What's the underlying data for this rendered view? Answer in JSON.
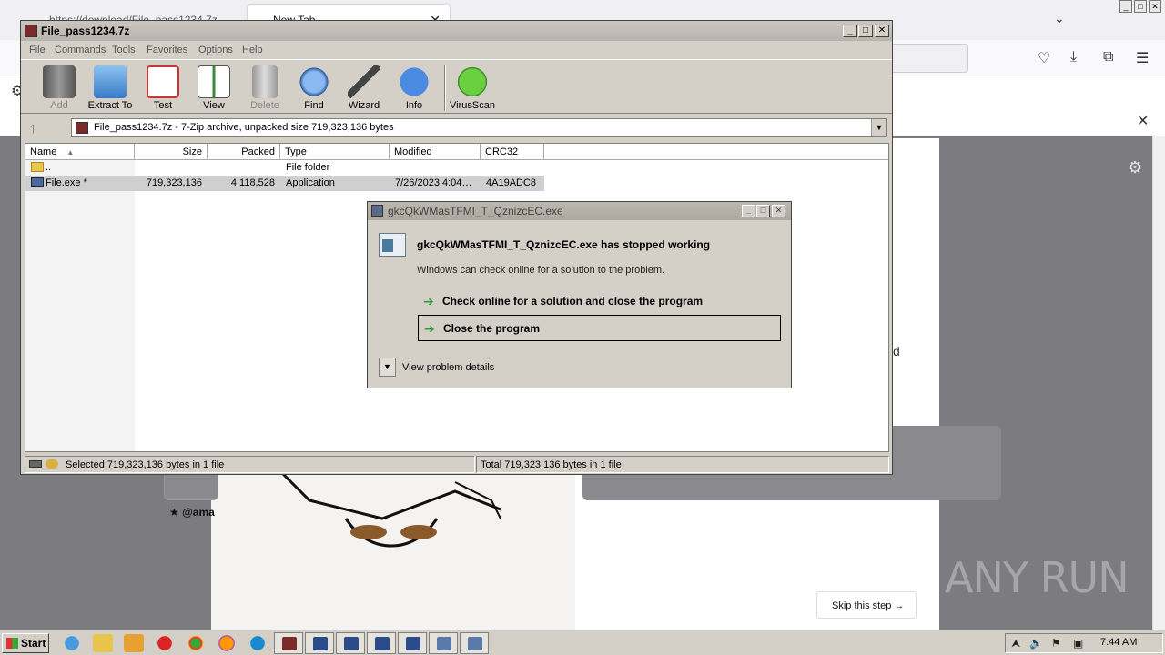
{
  "browser": {
    "tab_inactive_label": "https://download/File_pass1234.7z",
    "tab_active_label": "New Tab",
    "content": {
      "attribution": "★ @ama",
      "partial_text": "d",
      "skip_button": "Skip this step",
      "watermark": "ANY RUN"
    }
  },
  "winrar": {
    "title": "File_pass1234.7z",
    "menu": [
      "File",
      "Commands",
      "Tools",
      "Favorites",
      "Options",
      "Help"
    ],
    "toolbar": [
      {
        "label": "Add",
        "icon": "add-archive-icon",
        "enabled": false
      },
      {
        "label": "Extract To",
        "icon": "extract-folder-icon",
        "enabled": true
      },
      {
        "label": "Test",
        "icon": "test-checklist-icon",
        "enabled": true
      },
      {
        "label": "View",
        "icon": "view-book-icon",
        "enabled": true
      },
      {
        "label": "Delete",
        "icon": "trash-icon",
        "enabled": false
      },
      {
        "label": "Find",
        "icon": "magnifier-icon",
        "enabled": true
      },
      {
        "label": "Wizard",
        "icon": "wand-icon",
        "enabled": true
      },
      {
        "label": "Info",
        "icon": "info-icon",
        "enabled": true
      },
      {
        "label": "VirusScan",
        "icon": "virus-icon",
        "enabled": true
      }
    ],
    "address": "File_pass1234.7z - 7-Zip archive, unpacked size 719,323,136 bytes",
    "columns": [
      "Name",
      "Size",
      "Packed",
      "Type",
      "Modified",
      "CRC32"
    ],
    "rows": [
      {
        "name": "..",
        "size": "",
        "packed": "",
        "type": "File folder",
        "modified": "",
        "crc": ""
      },
      {
        "name": "File.exe *",
        "size": "719,323,136",
        "packed": "4,118,528",
        "type": "Application",
        "modified": "7/26/2023 4:04…",
        "crc": "4A19ADC8"
      }
    ],
    "status_left": "Selected 719,323,136 bytes in 1 file",
    "status_right": "Total 719,323,136 bytes in 1 file"
  },
  "dialog": {
    "title": "gkcQkWMasTFMI_T_QznizcEC.exe",
    "heading": "gkcQkWMasTFMI_T_QznizcEC.exe has stopped working",
    "subtext": "Windows can check online for a solution to the problem.",
    "option_check": "Check online for a solution and close the program",
    "option_close": "Close the program",
    "details": "View problem details"
  },
  "taskbar": {
    "start": "Start",
    "clock": "7:44 AM"
  },
  "colors": {
    "accent_green": "#2e9a3a",
    "title_bg": "#b8b4ad",
    "window_bg": "#d4d0c8"
  }
}
